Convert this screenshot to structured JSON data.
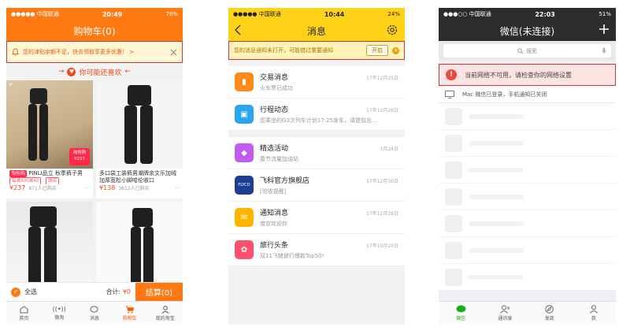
{
  "phone1": {
    "status": {
      "carrier": "●●●●● 中国联通",
      "time": "20:49",
      "battery": "78%"
    },
    "title": "购物车(0)",
    "notice": "您的津贴余额不足，快去领取享更多优惠！ >",
    "guess_title": "你可能还喜欢",
    "products": [
      {
        "name": "PINLI品立 秋季裤子男",
        "tag": "淘抢购",
        "promo": "每满300减40",
        "promo2": "跨店",
        "price": "¥237",
        "sold": "871人已购买",
        "sale_badge": "淘抢购 ¥237"
      },
      {
        "name": "多口袋工装裤男潮牌余文乐加绒加厚宽松小脚哈伦收口",
        "price": "¥138",
        "sold": "3612人已购买"
      }
    ],
    "select_all": "全选",
    "total_label": "合计:",
    "total_value": "¥0",
    "checkout": "结算(0)",
    "tabs": [
      "首页",
      "微淘",
      "消息",
      "购物车",
      "我的淘宝"
    ]
  },
  "phone2": {
    "status": {
      "carrier": "●●●●● 中国联通",
      "time": "10:44",
      "battery": "24%"
    },
    "title": "消息",
    "notice": "您的消息通知未打开，可能错过重要通知",
    "notice_btn": "开启",
    "messages": [
      {
        "title": "交易消息",
        "date": "17年12月25日",
        "sub": "火车票已成功",
        "color": "#ff8a1a"
      },
      {
        "title": "行程动态",
        "date": "17年12月26日",
        "sub": "您乘坐的G3次列车计划17:25发车，请提前出...",
        "color": "#2aa5f0"
      },
      {
        "title": "精选活动",
        "date": "1月24日",
        "sub": "春节流量加油站",
        "color": "#c25bf0"
      },
      {
        "title": "飞科官方旗舰店",
        "date": "17年12月30日",
        "sub": "[验收提醒]",
        "color": "#1c3f95"
      },
      {
        "title": "通知消息",
        "date": "17年12月28日",
        "sub": "南京欢迎你",
        "color": "#ffb400"
      },
      {
        "title": "旅行头条",
        "date": "17年10月20日",
        "sub": "双11飞猪旅行爆款Top50!",
        "color": "#ff4f6e"
      }
    ]
  },
  "phone3": {
    "status": {
      "carrier": "●●●○○ 中国联通",
      "time": "22:03",
      "battery": "51%"
    },
    "title": "微信(未连接)",
    "search_placeholder": "搜索",
    "network_error": "当前网络不可用，请检查你的网络设置",
    "mac_notice": "Mac 微信已登录，手机通知已关闭",
    "tabs": [
      "微信",
      "通讯录",
      "发现",
      "我"
    ]
  }
}
